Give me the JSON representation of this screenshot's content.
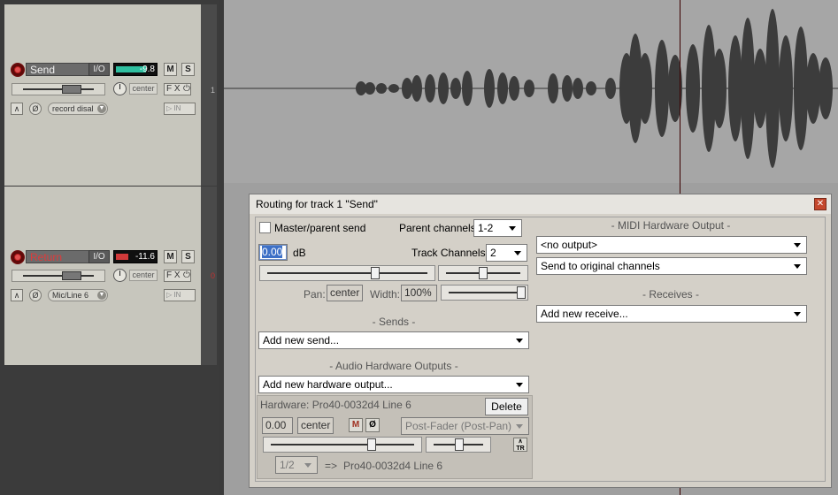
{
  "tracks": [
    {
      "number": "1",
      "name": "Send",
      "io_label": "I/O",
      "meter_value": "-9.8",
      "meter_color": "#2fbfa0",
      "mute_label": "M",
      "solo_label": "S",
      "pan_label": "center",
      "fx_label": "F X",
      "power_label": "⏻",
      "input_label": "record disal",
      "monitor_label": "▷ IN"
    },
    {
      "number": "0",
      "name": "Return",
      "io_label": "I/O",
      "meter_value": "-11.6",
      "meter_color": "#d23a3a",
      "mute_label": "M",
      "solo_label": "S",
      "pan_label": "center",
      "fx_label": "F X",
      "power_label": "⏻",
      "input_label": "Mic/Line 6",
      "monitor_label": "▷ IN"
    }
  ],
  "routing": {
    "title": "Routing for track 1 \"Send\"",
    "close_glyph": "✕",
    "master_parent_send_label": "Master/parent send",
    "master_parent_send_checked": false,
    "parent_channels_label": "Parent channels:",
    "parent_channels_value": "1-2",
    "volume_value": "0.00",
    "volume_unit": "dB",
    "track_channels_label": "Track Channels:",
    "track_channels_value": "2",
    "pan_label": "Pan:",
    "pan_value": "center",
    "width_label": "Width:",
    "width_value": "100%",
    "sends_header": "- Sends -",
    "add_send": "Add new send...",
    "audio_hw_header": "- Audio Hardware Outputs -",
    "add_hw_output": "Add new hardware output...",
    "hardware_label": "Hardware: Pro40-0032d4 Line 6",
    "delete_label": "Delete",
    "hw_volume": "0.00",
    "hw_pan": "center",
    "hw_mute": "M",
    "hw_phase": "Ø",
    "hw_mode": "Post-Fader (Post-Pan)",
    "hw_tr_label": "TR",
    "hw_channels": "1/2",
    "hw_arrow": "=>",
    "hw_dest": "Pro40-0032d4 Line 6",
    "midi_hw_header": "- MIDI Hardware Output -",
    "midi_output": "<no output>",
    "midi_channels": "Send to original channels",
    "receives_header": "- Receives -",
    "add_receive": "Add new receive..."
  }
}
